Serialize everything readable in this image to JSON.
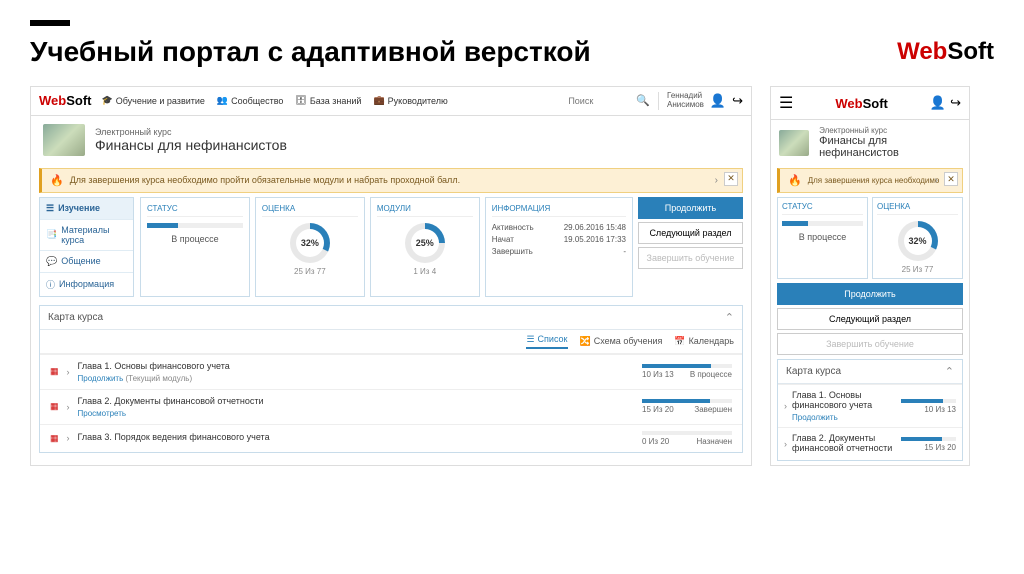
{
  "slide": {
    "title": "Учебный портал с адаптивной версткой"
  },
  "brand": {
    "w": "Web",
    "rest": "Soft"
  },
  "nav": {
    "learning": "Обучение и развитие",
    "community": "Сообщество",
    "kb": "База знаний",
    "manager": "Руководителю",
    "search_placeholder": "Поиск"
  },
  "user": {
    "first": "Геннадий",
    "last": "Анисимов"
  },
  "course": {
    "type": "Электронный курс",
    "title": "Финансы для нефинансистов"
  },
  "alert": {
    "text_desktop": "Для завершения курса необходимо пройти обязательные модули и набрать проходной балл.",
    "text_mobile": "Для завершения курса необходимо"
  },
  "sidebar": {
    "study": "Изучение",
    "materials": "Материалы курса",
    "discuss": "Общение",
    "info": "Информация"
  },
  "stats": {
    "status_label": "СТАТУС",
    "status_value": "В процессе",
    "score_label": "ОЦЕНКА",
    "score_pct": "32%",
    "score_sub": "25 Из 77",
    "modules_label": "МОДУЛИ",
    "modules_pct": "25%",
    "modules_sub": "1 Из 4",
    "info_label": "ИНФОРМАЦИЯ",
    "info_activity_l": "Активность",
    "info_activity_v": "29.06.2016 15:48",
    "info_started_l": "Начат",
    "info_started_v": "19.05.2016 17:33",
    "info_finish_l": "Завершить",
    "info_finish_v": "-"
  },
  "actions": {
    "continue": "Продолжить",
    "next": "Следующий раздел",
    "finish": "Завершить обучение"
  },
  "map": {
    "title": "Карта курса",
    "tab_list": "Список",
    "tab_scheme": "Схема обучения",
    "tab_calendar": "Календарь"
  },
  "chapters": [
    {
      "title": "Глава 1. Основы финансового учета",
      "link": "Продолжить",
      "hint": "(Текущий модуль)",
      "score": "10 Из 13",
      "status": "В процессе",
      "pct": 77
    },
    {
      "title": "Глава 2. Документы финансовой отчетности",
      "link": "Просмотреть",
      "hint": "",
      "score": "15 Из 20",
      "status": "Завершен",
      "pct": 75
    },
    {
      "title": "Глава 3. Порядок ведения финансового учета",
      "link": "",
      "hint": "",
      "score": "0 Из 20",
      "status": "Назначен",
      "pct": 0
    }
  ],
  "mobile_chapters": [
    {
      "title": "Глава 1. Основы финансового учета",
      "link": "Продолжить",
      "score": "10 Из 13",
      "pct": 77
    },
    {
      "title": "Глава 2. Документы финансовой отчетности",
      "link": "",
      "score": "15 Из 20",
      "pct": 75
    }
  ]
}
